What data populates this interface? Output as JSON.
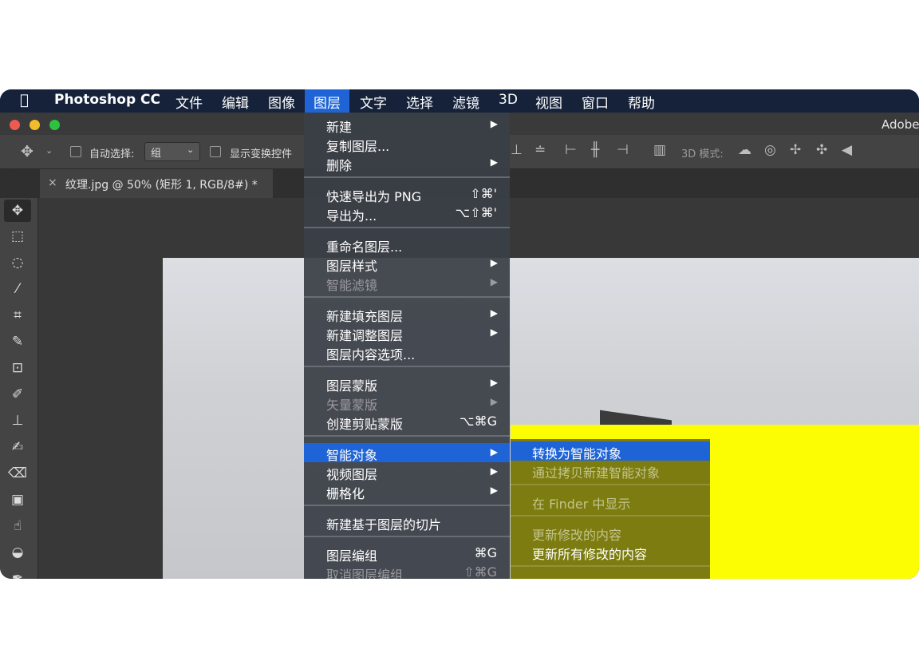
{
  "menubar": {
    "app_name": "Photoshop CC",
    "items": [
      "文件",
      "编辑",
      "图像",
      "图层",
      "文字",
      "选择",
      "滤镜",
      "3D",
      "视图",
      "窗口",
      "帮助"
    ],
    "active_item": "图层"
  },
  "titlebar": {
    "app_text": "Adobe"
  },
  "options": {
    "auto_select_label": "自动选择:",
    "auto_select_value": "组",
    "show_transform_label": "显示变换控件",
    "mode_3d_label": "3D 模式:"
  },
  "document_tab": {
    "title": "纹理.jpg @ 50% (矩形 1, RGB/8#) *"
  },
  "layer_menu": {
    "groups": [
      [
        {
          "label": "新建",
          "submenu": true
        },
        {
          "label": "复制图层...",
          "shortcut": ""
        },
        {
          "label": "删除",
          "submenu": true
        }
      ],
      [
        {
          "label": "快速导出为 PNG",
          "shortcut": "⇧⌘'"
        },
        {
          "label": "导出为...",
          "shortcut": "⌥⇧⌘'"
        }
      ],
      [
        {
          "label": "重命名图层..."
        },
        {
          "label": "图层样式",
          "submenu": true
        },
        {
          "label": "智能滤镜",
          "submenu": true,
          "disabled": true
        }
      ],
      [
        {
          "label": "新建填充图层",
          "submenu": true
        },
        {
          "label": "新建调整图层",
          "submenu": true
        },
        {
          "label": "图层内容选项..."
        }
      ],
      [
        {
          "label": "图层蒙版",
          "submenu": true
        },
        {
          "label": "矢量蒙版",
          "submenu": true,
          "disabled": true
        },
        {
          "label": "创建剪贴蒙版",
          "shortcut": "⌥⌘G"
        }
      ],
      [
        {
          "label": "智能对象",
          "submenu": true,
          "highlighted": true
        },
        {
          "label": "视频图层",
          "submenu": true
        },
        {
          "label": "栅格化",
          "submenu": true
        }
      ],
      [
        {
          "label": "新建基于图层的切片"
        }
      ],
      [
        {
          "label": "图层编组",
          "shortcut": "⌘G"
        },
        {
          "label": "取消图层编组",
          "shortcut": "⇧⌘G",
          "disabled": true
        }
      ]
    ]
  },
  "smart_object_submenu": {
    "items": [
      {
        "label": "转换为智能对象",
        "highlighted": true
      },
      {
        "label": "通过拷贝新建智能对象",
        "disabled": true
      },
      {
        "label": "在 Finder 中显示",
        "disabled": true
      },
      {
        "label": "更新修改的内容",
        "disabled": true
      },
      {
        "label": "更新所有修改的内容"
      }
    ]
  },
  "colors": {
    "menubar": "#15223a",
    "highlight": "#1f64d6",
    "canvas_yellow": "#fcfd03"
  },
  "toolbar": {
    "tools": [
      "move-tool",
      "marquee-tool",
      "lasso-tool",
      "magic-wand-tool",
      "crop-tool",
      "eyedropper-tool",
      "frame-tool",
      "brush-tool",
      "stamp-tool",
      "history-brush-tool",
      "eraser-tool",
      "gradient-tool",
      "smudge-tool",
      "dodge-tool",
      "pen-tool"
    ]
  }
}
